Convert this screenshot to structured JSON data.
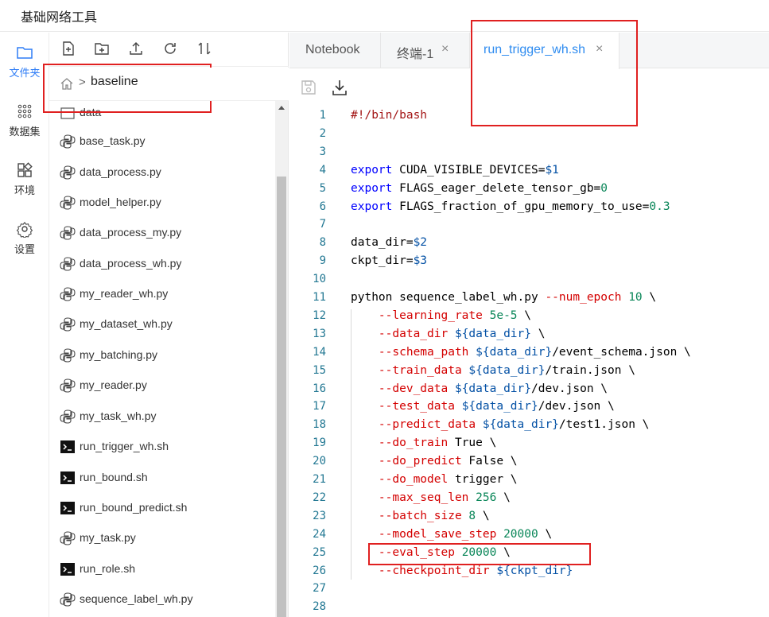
{
  "app": {
    "title": "基础网络工具"
  },
  "rail": [
    {
      "label": "文件夹",
      "icon": "folder-icon",
      "active": true
    },
    {
      "label": "数据集",
      "icon": "dataset-icon",
      "active": false
    },
    {
      "label": "环境",
      "icon": "environment-icon",
      "active": false
    },
    {
      "label": "设置",
      "icon": "gear-icon",
      "active": false
    }
  ],
  "file_toolbar": [
    "new-file-icon",
    "new-folder-icon",
    "upload-icon",
    "refresh-icon",
    "sort-icon"
  ],
  "breadcrumb": {
    "separator": ">",
    "current": "baseline"
  },
  "files": [
    {
      "name": "data",
      "type": "folder"
    },
    {
      "name": "base_task.py",
      "type": "python"
    },
    {
      "name": "data_process.py",
      "type": "python"
    },
    {
      "name": "model_helper.py",
      "type": "python"
    },
    {
      "name": "data_process_my.py",
      "type": "python"
    },
    {
      "name": "data_process_wh.py",
      "type": "python"
    },
    {
      "name": "my_reader_wh.py",
      "type": "python"
    },
    {
      "name": "my_dataset_wh.py",
      "type": "python"
    },
    {
      "name": "my_batching.py",
      "type": "python"
    },
    {
      "name": "my_reader.py",
      "type": "python"
    },
    {
      "name": "my_task_wh.py",
      "type": "python"
    },
    {
      "name": "run_trigger_wh.sh",
      "type": "shell"
    },
    {
      "name": "run_bound.sh",
      "type": "shell"
    },
    {
      "name": "run_bound_predict.sh",
      "type": "shell"
    },
    {
      "name": "my_task.py",
      "type": "python"
    },
    {
      "name": "run_role.sh",
      "type": "shell"
    },
    {
      "name": "sequence_label_wh.py",
      "type": "python"
    },
    {
      "name": "",
      "type": "shell"
    }
  ],
  "tabs": [
    {
      "label": "Notebook",
      "closable": false,
      "active": false
    },
    {
      "label": "终端-1",
      "closable": true,
      "active": false
    },
    {
      "label": "run_trigger_wh.sh",
      "closable": true,
      "active": true
    }
  ],
  "tab_close_glyph": "×",
  "editor_tools": [
    "save-icon",
    "download-icon"
  ],
  "code_lines": [
    {
      "n": "1",
      "tokens": [
        [
          "#!/bin/bash",
          "red"
        ]
      ]
    },
    {
      "n": "2",
      "tokens": []
    },
    {
      "n": "3",
      "tokens": []
    },
    {
      "n": "4",
      "tokens": [
        [
          "export",
          "blue"
        ],
        [
          " CUDA_VISIBLE_DEVICES=",
          "plain"
        ],
        [
          "$1",
          "var"
        ]
      ]
    },
    {
      "n": "5",
      "tokens": [
        [
          "export",
          "blue"
        ],
        [
          " FLAGS_eager_delete_tensor_gb=",
          "plain"
        ],
        [
          "0",
          "num"
        ]
      ]
    },
    {
      "n": "6",
      "tokens": [
        [
          "export",
          "blue"
        ],
        [
          " FLAGS_fraction_of_gpu_memory_to_use=",
          "plain"
        ],
        [
          "0.3",
          "num"
        ]
      ]
    },
    {
      "n": "7",
      "tokens": []
    },
    {
      "n": "8",
      "tokens": [
        [
          "data_dir=",
          "plain"
        ],
        [
          "$2",
          "var"
        ]
      ]
    },
    {
      "n": "9",
      "tokens": [
        [
          "ckpt_dir=",
          "plain"
        ],
        [
          "$3",
          "var"
        ]
      ]
    },
    {
      "n": "10",
      "tokens": []
    },
    {
      "n": "11",
      "tokens": [
        [
          "python sequence_label_wh.py ",
          "plain"
        ],
        [
          "--num_epoch",
          "flag"
        ],
        [
          " ",
          "plain"
        ],
        [
          "10",
          "num"
        ],
        [
          " \\",
          "plain"
        ]
      ]
    },
    {
      "n": "12",
      "tokens": [
        [
          "    ",
          "plain"
        ],
        [
          "--learning_rate",
          "flag"
        ],
        [
          " ",
          "plain"
        ],
        [
          "5e-5",
          "num"
        ],
        [
          " \\",
          "plain"
        ]
      ]
    },
    {
      "n": "13",
      "tokens": [
        [
          "    ",
          "plain"
        ],
        [
          "--data_dir",
          "flag"
        ],
        [
          " ",
          "plain"
        ],
        [
          "${data_dir}",
          "var"
        ],
        [
          " \\",
          "plain"
        ]
      ]
    },
    {
      "n": "14",
      "tokens": [
        [
          "    ",
          "plain"
        ],
        [
          "--schema_path",
          "flag"
        ],
        [
          " ",
          "plain"
        ],
        [
          "${data_dir}",
          "var"
        ],
        [
          "/event_schema.json \\",
          "plain"
        ]
      ]
    },
    {
      "n": "15",
      "tokens": [
        [
          "    ",
          "plain"
        ],
        [
          "--train_data",
          "flag"
        ],
        [
          " ",
          "plain"
        ],
        [
          "${data_dir}",
          "var"
        ],
        [
          "/train.json \\",
          "plain"
        ]
      ]
    },
    {
      "n": "16",
      "tokens": [
        [
          "    ",
          "plain"
        ],
        [
          "--dev_data",
          "flag"
        ],
        [
          " ",
          "plain"
        ],
        [
          "${data_dir}",
          "var"
        ],
        [
          "/dev.json \\",
          "plain"
        ]
      ]
    },
    {
      "n": "17",
      "tokens": [
        [
          "    ",
          "plain"
        ],
        [
          "--test_data",
          "flag"
        ],
        [
          " ",
          "plain"
        ],
        [
          "${data_dir}",
          "var"
        ],
        [
          "/dev.json \\",
          "plain"
        ]
      ]
    },
    {
      "n": "18",
      "tokens": [
        [
          "    ",
          "plain"
        ],
        [
          "--predict_data",
          "flag"
        ],
        [
          " ",
          "plain"
        ],
        [
          "${data_dir}",
          "var"
        ],
        [
          "/test1.json \\",
          "plain"
        ]
      ]
    },
    {
      "n": "19",
      "tokens": [
        [
          "    ",
          "plain"
        ],
        [
          "--do_train",
          "flag"
        ],
        [
          " True \\",
          "plain"
        ]
      ]
    },
    {
      "n": "20",
      "tokens": [
        [
          "    ",
          "plain"
        ],
        [
          "--do_predict",
          "flag"
        ],
        [
          " False \\",
          "plain"
        ]
      ]
    },
    {
      "n": "21",
      "tokens": [
        [
          "    ",
          "plain"
        ],
        [
          "--do_model",
          "flag"
        ],
        [
          " trigger \\",
          "plain"
        ]
      ]
    },
    {
      "n": "22",
      "tokens": [
        [
          "    ",
          "plain"
        ],
        [
          "--max_seq_len",
          "flag"
        ],
        [
          " ",
          "plain"
        ],
        [
          "256",
          "num"
        ],
        [
          " \\",
          "plain"
        ]
      ]
    },
    {
      "n": "23",
      "tokens": [
        [
          "    ",
          "plain"
        ],
        [
          "--batch_size",
          "flag"
        ],
        [
          " ",
          "plain"
        ],
        [
          "8",
          "num"
        ],
        [
          " \\",
          "plain"
        ]
      ]
    },
    {
      "n": "24",
      "tokens": [
        [
          "    ",
          "plain"
        ],
        [
          "--model_save_step",
          "flag"
        ],
        [
          " ",
          "plain"
        ],
        [
          "20000",
          "num"
        ],
        [
          " \\",
          "plain"
        ]
      ]
    },
    {
      "n": "25",
      "tokens": [
        [
          "    ",
          "plain"
        ],
        [
          "--eval_step",
          "flag"
        ],
        [
          " ",
          "plain"
        ],
        [
          "20000",
          "num"
        ],
        [
          " \\",
          "plain"
        ]
      ]
    },
    {
      "n": "26",
      "tokens": [
        [
          "    ",
          "plain"
        ],
        [
          "--checkpoint_dir",
          "flag"
        ],
        [
          " ",
          "plain"
        ],
        [
          "${ckpt_dir}",
          "var"
        ]
      ]
    },
    {
      "n": "27",
      "tokens": []
    },
    {
      "n": "28",
      "tokens": []
    }
  ],
  "colors": {
    "accent": "#2f8cf0",
    "highlight_box": "#e02020",
    "line_number": "#237893"
  }
}
